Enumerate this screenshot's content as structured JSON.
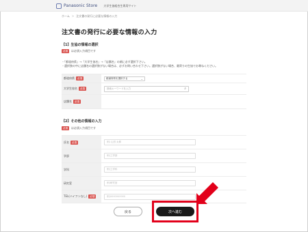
{
  "header": {
    "brand_name": "Panasonic Store",
    "brand_sub": "大学生協組合生専用サイト"
  },
  "breadcrumb": [
    "ホーム",
    "注文書の発行に必要な情報の入力"
  ],
  "page_title": "注文書の発行に必要な情報の入力",
  "section1": {
    "title": "【1】生協の情報の選択",
    "required_note": "は必須入力項目です",
    "notes": [
      "・「都道府県」→「大学生協名」→「店舗名」の順に必ず選択下さい。",
      "・選択肢の中に店舗名の選択肢がない場合は、必ずお問い合わせ下さい。選択肢がない場合、最寄りの生協でお尋ねください。"
    ],
    "rows": [
      {
        "label": "都道府県",
        "value": "都道府県を選択する"
      },
      {
        "label": "大学生協名",
        "placeholder": "検索キーワードを入力"
      },
      {
        "label": "店舗名",
        "value": ""
      }
    ]
  },
  "section2": {
    "title": "【2】その他の情報の入力",
    "required_note": "は必須入力項目です",
    "rows": [
      {
        "label": "氏名",
        "placeholder": "例) 山田 太郎"
      },
      {
        "label": "学部",
        "placeholder": "例)工学部"
      },
      {
        "label": "学科",
        "placeholder": "例)工学科"
      },
      {
        "label": "研究室",
        "placeholder": "例)研究室"
      },
      {
        "label": "TEL(ハイフンなし)",
        "placeholder": "例)0000000000"
      }
    ]
  },
  "badge_label": "必須",
  "buttons": {
    "back": "戻る",
    "next": "次へ進む"
  }
}
